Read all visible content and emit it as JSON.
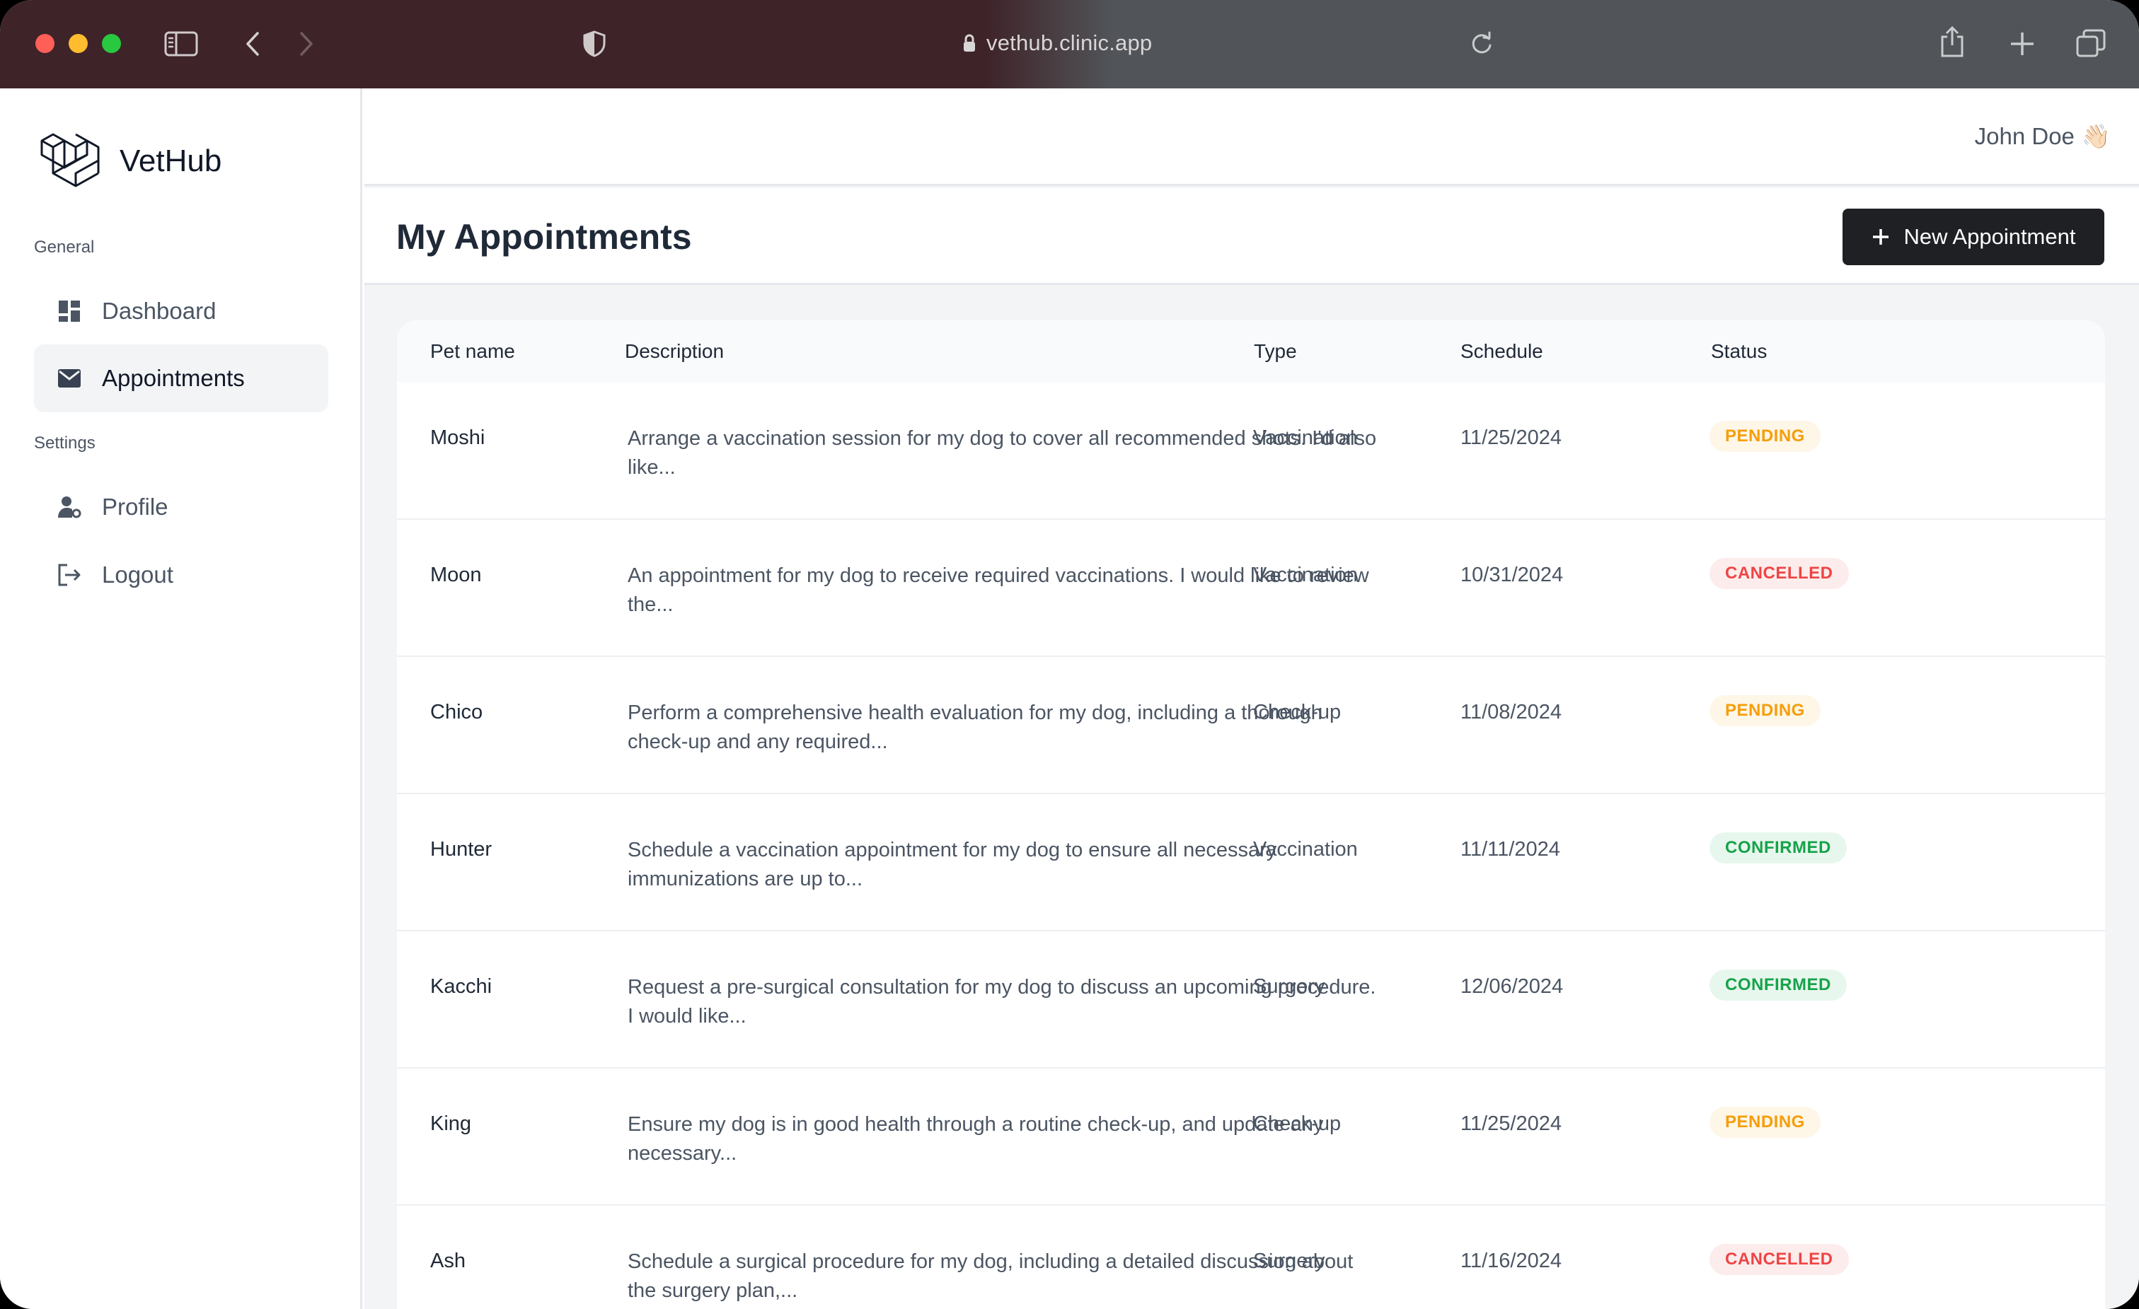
{
  "browser": {
    "url": "vethub.clinic.app"
  },
  "sidebar": {
    "brand": "VetHub",
    "sections": [
      {
        "label": "General",
        "items": [
          {
            "label": "Dashboard",
            "icon": "dashboard-icon"
          },
          {
            "label": "Appointments",
            "icon": "envelope-icon",
            "active": true
          }
        ]
      },
      {
        "label": "Settings",
        "items": [
          {
            "label": "Profile",
            "icon": "user-gear-icon"
          },
          {
            "label": "Logout",
            "icon": "logout-icon"
          }
        ]
      }
    ]
  },
  "topbar": {
    "user_name": "John Doe",
    "user_emoji": "👋🏻"
  },
  "header": {
    "title": "My Appointments",
    "new_button_label": "New Appointment"
  },
  "table": {
    "columns": [
      "Pet name",
      "Description",
      "Type",
      "Schedule",
      "Status"
    ],
    "rows": [
      {
        "pet": "Moshi",
        "description": "Arrange a vaccination session for my dog to cover all recommended shots. I'd also like...",
        "type": "Vaccination",
        "schedule": "11/25/2024",
        "status": "PENDING"
      },
      {
        "pet": "Moon",
        "description": "An appointment for my dog to receive required vaccinations. I would like to review the...",
        "type": "Vaccination",
        "schedule": "10/31/2024",
        "status": "CANCELLED"
      },
      {
        "pet": "Chico",
        "description": "Perform a comprehensive health evaluation for my dog, including a thorough check-up and any required...",
        "type": "Check-up",
        "schedule": "11/08/2024",
        "status": "PENDING"
      },
      {
        "pet": "Hunter",
        "description": "Schedule a vaccination appointment for my dog to ensure all necessary immunizations are up to...",
        "type": "Vaccination",
        "schedule": "11/11/2024",
        "status": "CONFIRMED"
      },
      {
        "pet": "Kacchi",
        "description": "Request a pre-surgical consultation for my dog to discuss an upcoming procedure. I would like...",
        "type": "Surgery",
        "schedule": "12/06/2024",
        "status": "CONFIRMED"
      },
      {
        "pet": "King",
        "description": "Ensure my dog is in good health through a routine check-up, and update any necessary...",
        "type": "Check-up",
        "schedule": "11/25/2024",
        "status": "PENDING"
      },
      {
        "pet": "Ash",
        "description": "Schedule a surgical procedure for my dog, including a detailed discussion about the surgery plan,...",
        "type": "Surgery",
        "schedule": "11/16/2024",
        "status": "CANCELLED"
      }
    ]
  },
  "status_colors": {
    "PENDING": {
      "text": "#f59e0b",
      "bg": "#fef6e7"
    },
    "CANCELLED": {
      "text": "#ef4444",
      "bg": "#fdecec"
    },
    "CONFIRMED": {
      "text": "#16a34a",
      "bg": "#e8f7ee"
    }
  }
}
